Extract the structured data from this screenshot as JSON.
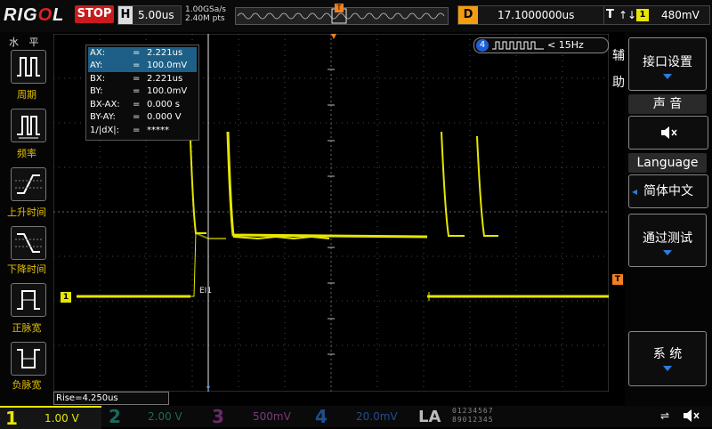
{
  "top": {
    "brand": "RIGOL",
    "run_state": "STOP",
    "timebase_key": "H",
    "timebase": "5.00us",
    "sample_rate": "1.00GSa/s",
    "mem_depth": "2.40M pts",
    "delay_key": "D",
    "delay": "17.1000000us",
    "trigger_key": "T",
    "trigger_edge": "↑↓",
    "trigger_source": "1",
    "trigger_level": "480mV",
    "trigger_pos_marker": "T"
  },
  "left_menu": {
    "title": "水 平",
    "items": [
      {
        "label": "周期",
        "icon": "period-icon"
      },
      {
        "label": "频率",
        "icon": "frequency-icon"
      },
      {
        "label": "上升时间",
        "icon": "rise-time-icon"
      },
      {
        "label": "下降时间",
        "icon": "fall-time-icon"
      },
      {
        "label": "正脉宽",
        "icon": "positive-width-icon"
      },
      {
        "label": "负脉宽",
        "icon": "negative-width-icon"
      }
    ]
  },
  "right_menu": {
    "aux_label": "辅助",
    "interface": "接口设置",
    "sound_header": "声 音",
    "sound_icon": "speaker-mute-icon",
    "language_header": "Language",
    "language_value": "简体中文",
    "pass_fail": "通过测试",
    "system": "系 统"
  },
  "cursor": {
    "rows": [
      {
        "name": "AX:",
        "eq": "=",
        "value": "2.221us",
        "selected": true
      },
      {
        "name": "AY:",
        "eq": "=",
        "value": "100.0mV",
        "selected": true
      },
      {
        "name": "BX:",
        "eq": "=",
        "value": "2.221us",
        "selected": false
      },
      {
        "name": "BY:",
        "eq": "=",
        "value": "100.0mV",
        "selected": false
      },
      {
        "name": "BX-AX:",
        "eq": "=",
        "value": "0.000 s",
        "selected": false
      },
      {
        "name": "BY-AY:",
        "eq": "=",
        "value": "0.000 V",
        "selected": false
      },
      {
        "name": "1/|dX|:",
        "eq": "=",
        "value": "*****",
        "selected": false
      }
    ],
    "ab_label": "EI1"
  },
  "frequency_counter": {
    "channel": "4",
    "value": "< 15Hz"
  },
  "measurement": "Rise=4.250us",
  "channels": [
    {
      "num": "1",
      "scale": "1.00 V",
      "color": "#e6e600"
    },
    {
      "num": "2",
      "scale": "2.00 V",
      "color": "#1b6a5a"
    },
    {
      "num": "3",
      "scale": "500mV",
      "color": "#7a3a7a"
    },
    {
      "num": "4",
      "scale": "20.0mV",
      "color": "#1e4e8e"
    }
  ],
  "la": {
    "label": "LA",
    "digits_row1": "01234567",
    "digits_row2": "89012345"
  },
  "ch1_marker": "1",
  "trigger_marker": "T",
  "colors": {
    "ch1": "#e6e600",
    "trigger": "#f08020",
    "accent": "#2a7de0",
    "stop": "#c81c1c"
  }
}
